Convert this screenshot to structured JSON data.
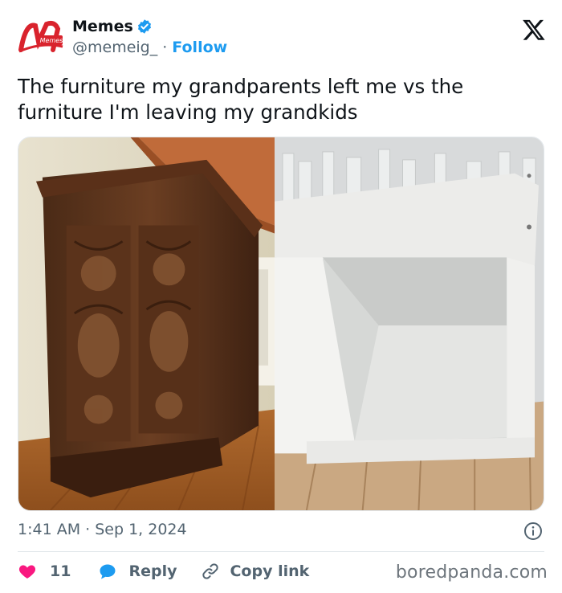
{
  "account": {
    "name": "Memes",
    "handle": "@memeig_",
    "separator": "·",
    "follow_label": "Follow",
    "logo_text": "Memes"
  },
  "icons": {
    "verified": "verified-badge-icon",
    "platform": "x-logo-icon",
    "info": "info-icon",
    "like": "heart-icon",
    "reply": "speech-bubble-icon",
    "copy": "link-icon"
  },
  "tweet": {
    "text": "The furniture my grandparents left me vs the furniture I'm leaving my grandkids",
    "timestamp": "1:41 AM · Sep 1, 2024"
  },
  "actions": {
    "like_count": "11",
    "reply_label": "Reply",
    "copy_label": "Copy link"
  },
  "watermark": "boredpanda.com",
  "colors": {
    "accent": "#1d9bf0",
    "like": "#f91880",
    "text": "#0f1419",
    "muted": "#536471"
  }
}
